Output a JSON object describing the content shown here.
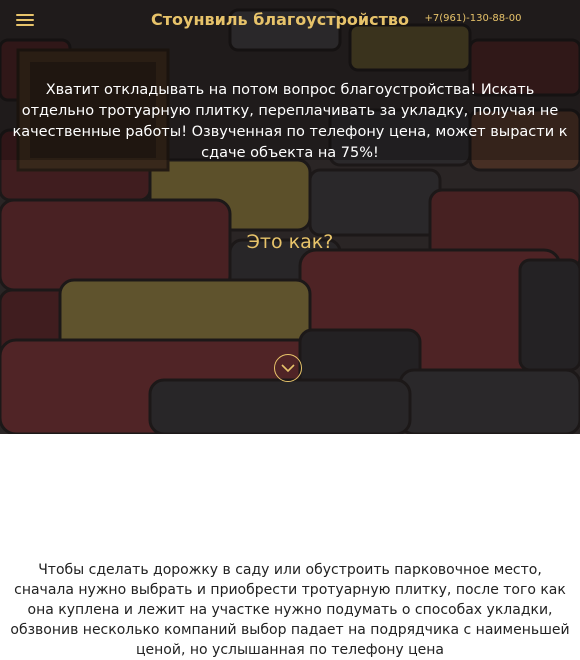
{
  "header": {
    "menu_icon": "hamburger-menu-icon",
    "title": "Стоунвиль благоустройство",
    "phone": "+7(961)-130-88-00"
  },
  "hero": {
    "intro": "Хватит откладывать на потом вопрос благоустройства! Искать отдельно тротуарную плитку, переплачивать за укладку, получая не качественные работы! Озвученная по телефону цена, может вырасти к сдаче объекта на 75%!",
    "question": "Это как?",
    "scroll_icon": "chevron-down-circle-icon"
  },
  "content": {
    "paragraph": "Чтобы сделать дорожку в саду или обустроить парковочное место, сначала нужно выбрать и приобрести тротуарную плитку, после того как она куплена и лежит на участке нужно подумать о способах укладки, обзвонив несколько компаний выбор падает на подрядчика с наименьшей ценой, но услышанная по телефону цена"
  },
  "colors": {
    "accent": "#e7c36a",
    "hero_overlay": "#1e1a1a",
    "body_text": "#222222"
  }
}
